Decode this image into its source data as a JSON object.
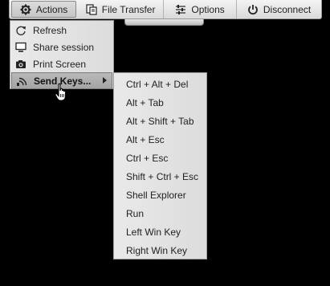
{
  "toolbar": {
    "actions_label": "Actions",
    "file_transfer_label": "File Transfer",
    "options_label": "Options",
    "disconnect_label": "Disconnect"
  },
  "actions_menu": {
    "items": [
      {
        "label": "Refresh",
        "icon": "refresh-icon"
      },
      {
        "label": "Share session",
        "icon": "monitor-icon"
      },
      {
        "label": "Print Screen",
        "icon": "camera-icon"
      },
      {
        "label": "Send Keys...",
        "icon": "signal-icon",
        "selected": true,
        "has_submenu": true
      }
    ]
  },
  "send_keys_menu": {
    "items": [
      "Ctrl + Alt + Del",
      "Alt + Tab",
      "Alt + Shift + Tab",
      "Alt + Esc",
      "Ctrl + Esc",
      "Shift + Ctrl + Esc",
      "Shell Explorer",
      "Run",
      "Left Win Key",
      "Right Win Key"
    ]
  },
  "colors": {
    "background": "#000000",
    "menu_bg": "#e3e3e3",
    "selected_bg": "#aeaeae"
  }
}
